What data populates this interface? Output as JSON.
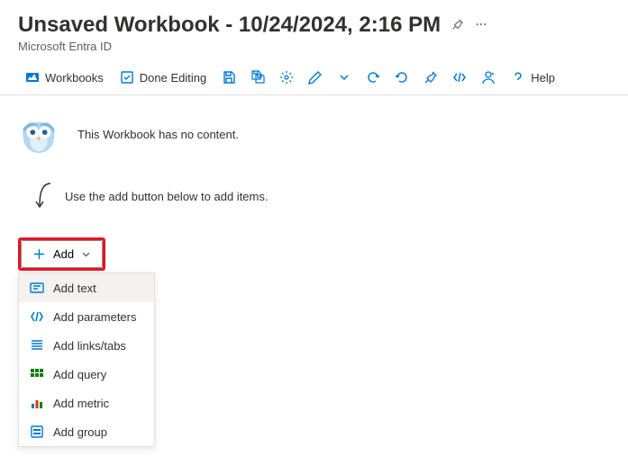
{
  "header": {
    "title": "Unsaved Workbook - 10/24/2024, 2:16 PM",
    "subtitle": "Microsoft Entra ID"
  },
  "toolbar": {
    "workbooks": "Workbooks",
    "doneEditing": "Done Editing",
    "help": "Help"
  },
  "content": {
    "noContent": "This Workbook has no content.",
    "useAdd": "Use the add button below to add items."
  },
  "addButton": {
    "label": "Add"
  },
  "dropdown": {
    "addText": "Add text",
    "addParameters": "Add parameters",
    "addLinksTabs": "Add links/tabs",
    "addQuery": "Add query",
    "addMetric": "Add metric",
    "addGroup": "Add group"
  }
}
